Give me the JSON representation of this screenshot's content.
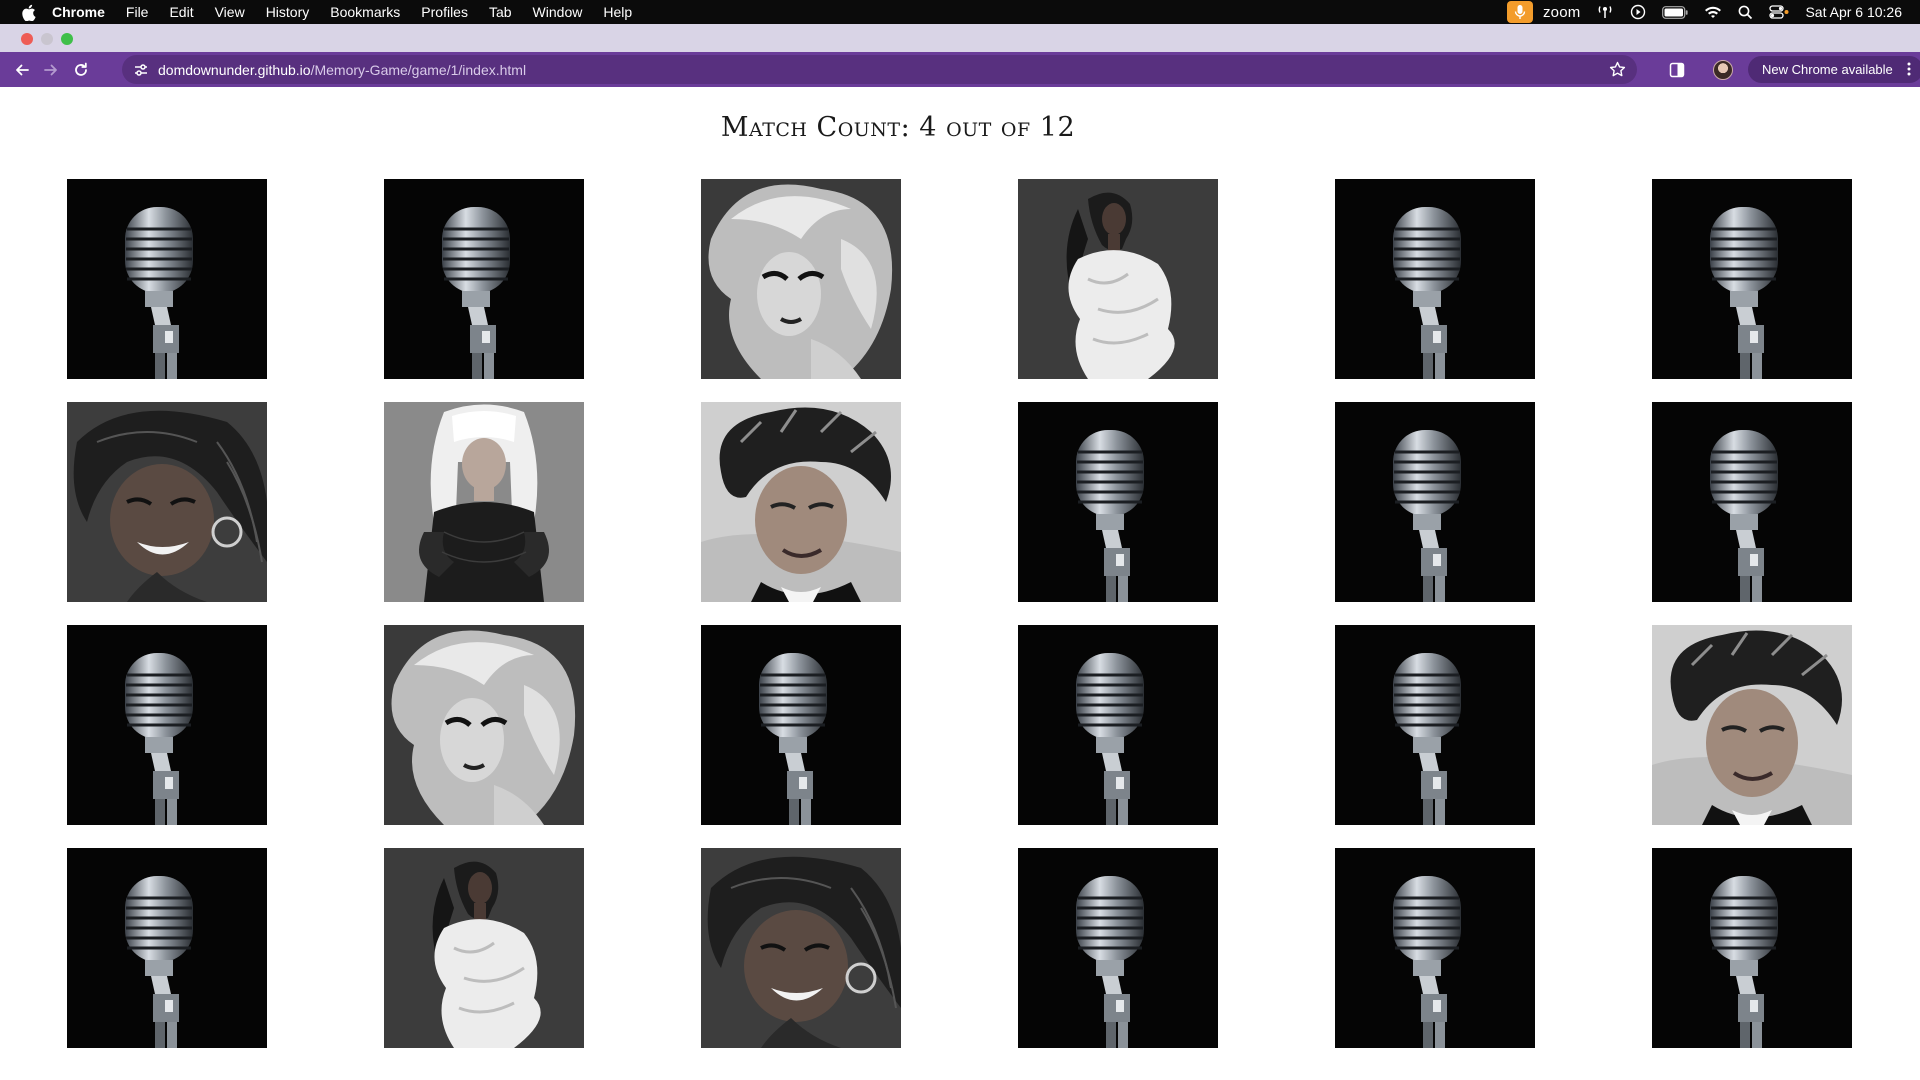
{
  "menubar": {
    "items": [
      "Chrome",
      "File",
      "Edit",
      "View",
      "History",
      "Bookmarks",
      "Profiles",
      "Tab",
      "Window",
      "Help"
    ],
    "zoom_label": "zoom",
    "clock": "Sat Apr 6  10:26"
  },
  "browser": {
    "url_host": "domdownunder.github.io",
    "url_path": "/Memory-Game/game/1/index.html",
    "update_button": "New Chrome available"
  },
  "colors": {
    "toolbar": "#6a3c99",
    "tabstrip": "#d9d4e6",
    "accent_orange": "#f39c2b"
  },
  "game": {
    "title_prefix": "Match Count:",
    "match_count": "4",
    "title_middle": "out of",
    "total": "12",
    "columns": 6,
    "rows": 4,
    "cards": [
      {
        "state": "hidden",
        "image": "microphone"
      },
      {
        "state": "hidden",
        "image": "microphone"
      },
      {
        "state": "revealed",
        "image": "singer-voluminous-blonde-hair"
      },
      {
        "state": "revealed",
        "image": "singer-white-ruffled-dress"
      },
      {
        "state": "hidden",
        "image": "microphone"
      },
      {
        "state": "hidden",
        "image": "microphone"
      },
      {
        "state": "revealed",
        "image": "singer-braids-smiling"
      },
      {
        "state": "revealed",
        "image": "singer-platinum-hair-black-lace"
      },
      {
        "state": "revealed",
        "image": "singer-short-spiky-hair"
      },
      {
        "state": "hidden",
        "image": "microphone"
      },
      {
        "state": "hidden",
        "image": "microphone"
      },
      {
        "state": "hidden",
        "image": "microphone"
      },
      {
        "state": "hidden",
        "image": "microphone"
      },
      {
        "state": "revealed",
        "image": "singer-voluminous-blonde-hair"
      },
      {
        "state": "hidden",
        "image": "microphone"
      },
      {
        "state": "hidden",
        "image": "microphone"
      },
      {
        "state": "hidden",
        "image": "microphone"
      },
      {
        "state": "revealed",
        "image": "singer-short-spiky-hair"
      },
      {
        "state": "hidden",
        "image": "microphone"
      },
      {
        "state": "revealed",
        "image": "singer-white-ruffled-dress"
      },
      {
        "state": "revealed",
        "image": "singer-braids-smiling"
      },
      {
        "state": "hidden",
        "image": "microphone"
      },
      {
        "state": "hidden",
        "image": "microphone"
      },
      {
        "state": "hidden",
        "image": "microphone"
      }
    ]
  }
}
